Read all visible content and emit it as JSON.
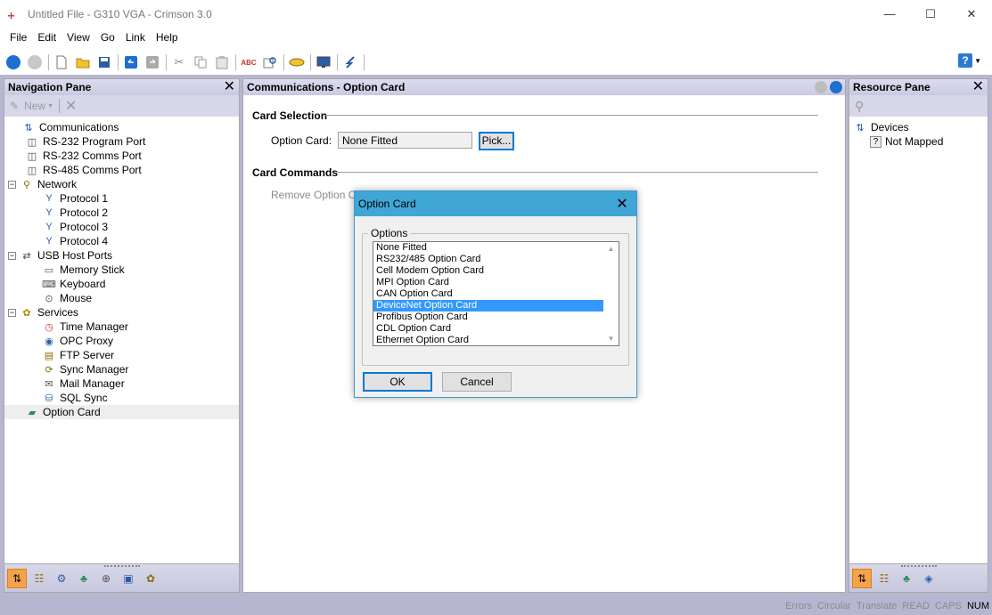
{
  "window": {
    "title": "Untitled File - G310 VGA - Crimson 3.0",
    "minimize": "—",
    "maximize": "☐",
    "close": "✕"
  },
  "menu": [
    "File",
    "Edit",
    "View",
    "Go",
    "Link",
    "Help"
  ],
  "nav_pane": {
    "title": "Navigation Pane",
    "new_label": "New",
    "tree": [
      {
        "label": "Communications",
        "level": 0,
        "icon": "communications-icon"
      },
      {
        "label": "RS-232 Program Port",
        "level": 1,
        "icon": "port-icon"
      },
      {
        "label": "RS-232 Comms Port",
        "level": 1,
        "icon": "port-icon"
      },
      {
        "label": "RS-485 Comms Port",
        "level": 1,
        "icon": "port-icon"
      },
      {
        "label": "Network",
        "level": 0,
        "expander": "−",
        "icon": "network-icon"
      },
      {
        "label": "Protocol 1",
        "level": 2,
        "icon": "protocol-icon"
      },
      {
        "label": "Protocol 2",
        "level": 2,
        "icon": "protocol-icon"
      },
      {
        "label": "Protocol 3",
        "level": 2,
        "icon": "protocol-icon"
      },
      {
        "label": "Protocol 4",
        "level": 2,
        "icon": "protocol-icon"
      },
      {
        "label": "USB Host Ports",
        "level": 0,
        "expander": "−",
        "icon": "usb-icon"
      },
      {
        "label": "Memory Stick",
        "level": 2,
        "icon": "memory-stick-icon"
      },
      {
        "label": "Keyboard",
        "level": 2,
        "icon": "keyboard-icon"
      },
      {
        "label": "Mouse",
        "level": 2,
        "icon": "mouse-icon"
      },
      {
        "label": "Services",
        "level": 0,
        "expander": "−",
        "icon": "services-icon"
      },
      {
        "label": "Time Manager",
        "level": 2,
        "icon": "clock-icon"
      },
      {
        "label": "OPC Proxy",
        "level": 2,
        "icon": "opc-icon"
      },
      {
        "label": "FTP Server",
        "level": 2,
        "icon": "ftp-icon"
      },
      {
        "label": "Sync Manager",
        "level": 2,
        "icon": "sync-icon"
      },
      {
        "label": "Mail Manager",
        "level": 2,
        "icon": "mail-icon"
      },
      {
        "label": "SQL Sync",
        "level": 2,
        "icon": "sql-icon"
      },
      {
        "label": "Option Card",
        "level": 1,
        "icon": "option-card-icon",
        "selected": true
      }
    ]
  },
  "center": {
    "title": "Communications - Option Card",
    "card_selection_title": "Card Selection",
    "option_card_label": "Option Card:",
    "option_card_value": "None Fitted",
    "pick_label": "Pick...",
    "card_commands_title": "Card Commands",
    "remove_label": "Remove Option Card"
  },
  "resource_pane": {
    "title": "Resource Pane",
    "devices_label": "Devices",
    "not_mapped_label": "Not Mapped"
  },
  "dialog": {
    "title": "Option Card",
    "group_label": "Options",
    "options": [
      "None Fitted",
      "RS232/485 Option Card",
      "Cell Modem Option Card",
      "MPI Option Card",
      "CAN Option Card",
      "DeviceNet Option Card",
      "Profibus Option Card",
      "CDL Option Card",
      "Ethernet Option Card"
    ],
    "selected_index": 5,
    "ok_label": "OK",
    "cancel_label": "Cancel"
  },
  "status": [
    {
      "label": "Errors",
      "on": false
    },
    {
      "label": "Circular",
      "on": false
    },
    {
      "label": "Translate",
      "on": false
    },
    {
      "label": "READ",
      "on": false
    },
    {
      "label": "CAPS",
      "on": false
    },
    {
      "label": "NUM",
      "on": true
    }
  ],
  "colors": {
    "pane_header": "#c9c9e2",
    "selection": "#3399ff",
    "dialog_title": "#3fa6d6",
    "accent": "#f5a24a"
  }
}
